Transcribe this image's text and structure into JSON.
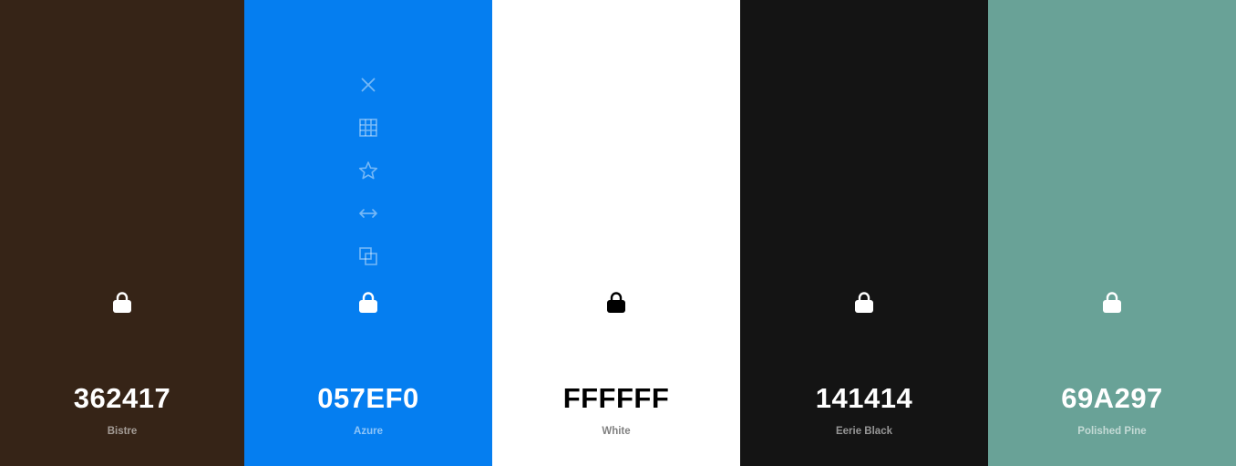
{
  "palette": {
    "swatches": [
      {
        "hex": "362417",
        "name": "Bistre",
        "bg": "#362417",
        "text_color": "#FFFFFF",
        "name_color": "rgba(255,255,255,0.55)",
        "lock_color": "#FFFFFF",
        "lock_icon": "lock-icon"
      },
      {
        "hex": "057EF0",
        "name": "Azure",
        "bg": "#057EF0",
        "text_color": "#FFFFFF",
        "name_color": "rgba(255,255,255,0.55)",
        "lock_color": "#FFFFFF",
        "lock_icon": "lock-icon",
        "tools": [
          {
            "icon": "close-icon"
          },
          {
            "icon": "grid-icon"
          },
          {
            "icon": "star-icon"
          },
          {
            "icon": "drag-arrows-icon"
          },
          {
            "icon": "copy-icon"
          }
        ],
        "tool_color": "rgba(255,255,255,0.45)"
      },
      {
        "hex": "FFFFFF",
        "name": "White",
        "bg": "#FFFFFF",
        "text_color": "#000000",
        "name_color": "rgba(0,0,0,0.5)",
        "lock_color": "#000000",
        "lock_icon": "lock-icon"
      },
      {
        "hex": "141414",
        "name": "Eerie Black",
        "bg": "#141414",
        "text_color": "#FFFFFF",
        "name_color": "rgba(255,255,255,0.55)",
        "lock_color": "#FFFFFF",
        "lock_icon": "lock-icon"
      },
      {
        "hex": "69A297",
        "name": "Polished Pine",
        "bg": "#69A297",
        "text_color": "#FFFFFF",
        "name_color": "rgba(255,255,255,0.6)",
        "lock_color": "#FFFFFF",
        "lock_icon": "lock-icon"
      }
    ]
  }
}
